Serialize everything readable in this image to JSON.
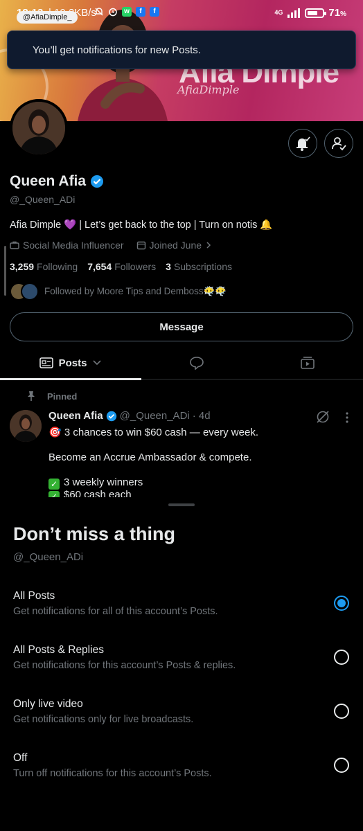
{
  "status_bar": {
    "time": "18:13",
    "speed": "| 10.2KB/s",
    "network": "4G",
    "battery": "71",
    "battery_suffix": "%",
    "battery_level": 0.71
  },
  "banner": {
    "handle_chip": "@AfiaDimple_",
    "brand_text": "Afia Dimple",
    "signature": "AfiaDimple"
  },
  "toast": {
    "message": "You’ll get notifications for new Posts."
  },
  "profile": {
    "name": "Queen Afia",
    "handle": "@_Queen_ADi",
    "bio": "Afia Dimple 💜 | Let’s get back to the top | Turn on notis 🔔",
    "category": "Social Media Influencer",
    "joined": "Joined June",
    "following_count": "3,259",
    "following_label": "Following",
    "followers_count": "7,654",
    "followers_label": "Followers",
    "subscriptions_count": "3",
    "subscriptions_label": "Subscriptions",
    "followed_by": "Followed by Moore Tips and Demboss😶‍🌫️😶‍🌫️",
    "message_button": "Message"
  },
  "tabs": {
    "posts": "Posts"
  },
  "post": {
    "pinned_label": "Pinned",
    "author": "Queen Afia",
    "handle": "@_Queen_ADi",
    "time": "· 4d",
    "line1": "🎯 3 chances to win $60 cash — every week.",
    "line2": "Become an Accrue Ambassador & compete.",
    "line3": "3 weekly winners",
    "line4": "$60 cash each"
  },
  "sheet": {
    "title": "Don’t miss a thing",
    "handle": "@_Queen_ADi",
    "options": [
      {
        "label": "All Posts",
        "desc": "Get notifications for all of this account’s Posts.",
        "selected": true
      },
      {
        "label": "All Posts & Replies",
        "desc": "Get notifications for this account’s Posts & replies.",
        "selected": false
      },
      {
        "label": "Only live video",
        "desc": "Get notifications only for live broadcasts.",
        "selected": false
      },
      {
        "label": "Off",
        "desc": "Turn off notifications for this account’s Posts.",
        "selected": false
      }
    ]
  },
  "colors": {
    "accent": "#1d9bf0",
    "background": "#000000",
    "secondary_text": "#71767b"
  }
}
